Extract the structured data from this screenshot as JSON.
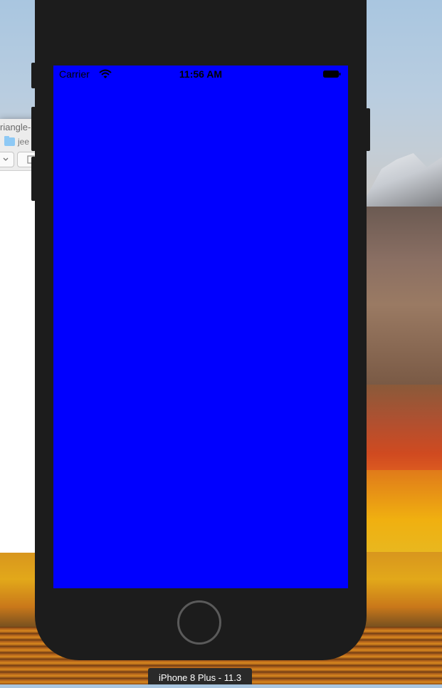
{
  "finder": {
    "title_partial": "riangle-",
    "path_partial": "jee"
  },
  "simulator": {
    "status_bar": {
      "carrier": "Carrier",
      "time": "11:56 AM",
      "wifi_icon": "wifi-icon",
      "battery_icon": "battery-icon"
    },
    "screen_color": "#0000ff",
    "device_label": "iPhone 8 Plus - 11.3"
  }
}
